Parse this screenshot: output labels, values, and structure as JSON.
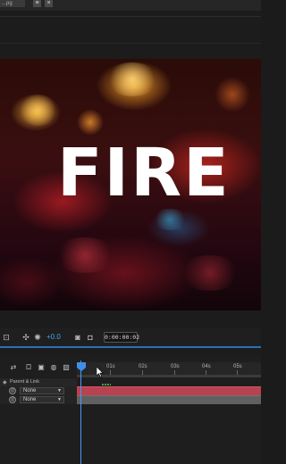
{
  "window": {
    "top_tab_label": "...pg"
  },
  "viewer": {
    "title_text": "FIRE"
  },
  "viewer_toolbar": {
    "exposure_value": "+0.0",
    "timecode": "0:00:00:02",
    "accent_color": "#3fa9f5"
  },
  "timeline": {
    "ruler_labels": [
      "01s",
      "02s",
      "03s",
      "04s",
      "05s"
    ],
    "columns": {
      "parent_link_label": "Parent & Link"
    },
    "layers": [
      {
        "parent": "None",
        "bar_color": "#b8424f"
      },
      {
        "parent": "None",
        "bar_color": "#606060"
      }
    ],
    "playhead_color": "#4a9af0"
  }
}
